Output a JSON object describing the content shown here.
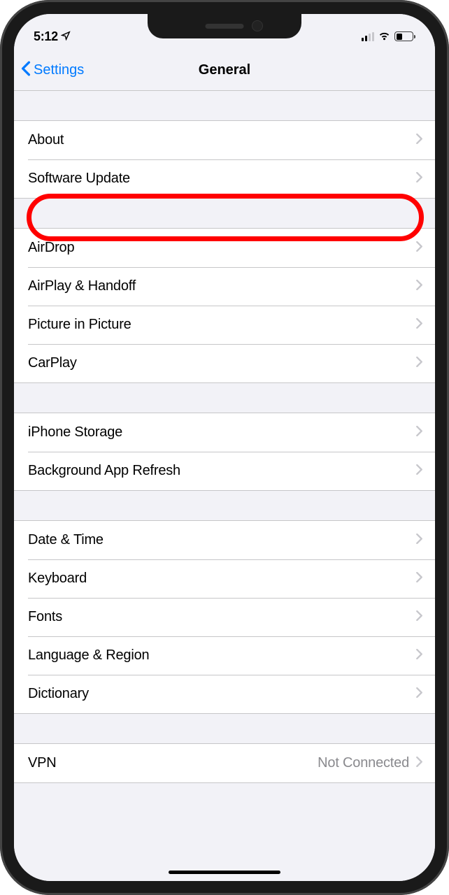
{
  "status_bar": {
    "time": "5:12",
    "location_icon": "location-arrow-icon"
  },
  "nav": {
    "back_label": "Settings",
    "title": "General"
  },
  "groups": [
    {
      "items": [
        {
          "id": "about",
          "label": "About"
        },
        {
          "id": "software-update",
          "label": "Software Update",
          "highlighted": true
        }
      ]
    },
    {
      "items": [
        {
          "id": "airdrop",
          "label": "AirDrop"
        },
        {
          "id": "airplay-handoff",
          "label": "AirPlay & Handoff"
        },
        {
          "id": "picture-in-picture",
          "label": "Picture in Picture"
        },
        {
          "id": "carplay",
          "label": "CarPlay"
        }
      ]
    },
    {
      "items": [
        {
          "id": "iphone-storage",
          "label": "iPhone Storage"
        },
        {
          "id": "background-app-refresh",
          "label": "Background App Refresh"
        }
      ]
    },
    {
      "items": [
        {
          "id": "date-time",
          "label": "Date & Time"
        },
        {
          "id": "keyboard",
          "label": "Keyboard"
        },
        {
          "id": "fonts",
          "label": "Fonts"
        },
        {
          "id": "language-region",
          "label": "Language & Region"
        },
        {
          "id": "dictionary",
          "label": "Dictionary"
        }
      ]
    },
    {
      "items": [
        {
          "id": "vpn",
          "label": "VPN",
          "detail": "Not Connected"
        }
      ]
    }
  ]
}
